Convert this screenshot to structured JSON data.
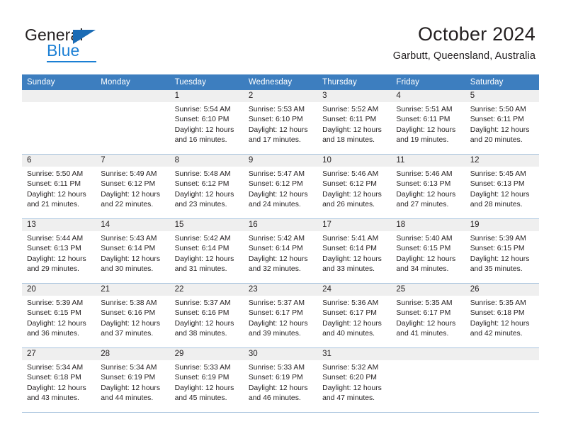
{
  "brand": {
    "name_part1": "General",
    "name_part2": "Blue",
    "accent_color": "#1b7fd4",
    "triangle_color": "#1b6cb5"
  },
  "header": {
    "title": "October 2024",
    "subtitle": "Garbutt, Queensland, Australia",
    "header_bg": "#3d7ebf",
    "daynum_bg": "#efefef"
  },
  "weekdays": [
    "Sunday",
    "Monday",
    "Tuesday",
    "Wednesday",
    "Thursday",
    "Friday",
    "Saturday"
  ],
  "labels": {
    "sunrise": "Sunrise:",
    "sunset": "Sunset:",
    "daylight": "Daylight:"
  },
  "weeks": [
    [
      {
        "day": "",
        "sunrise": "",
        "sunset": "",
        "daylight_line1": "",
        "daylight_line2": ""
      },
      {
        "day": "",
        "sunrise": "",
        "sunset": "",
        "daylight_line1": "",
        "daylight_line2": ""
      },
      {
        "day": "1",
        "sunrise": "Sunrise: 5:54 AM",
        "sunset": "Sunset: 6:10 PM",
        "daylight_line1": "Daylight: 12 hours",
        "daylight_line2": "and 16 minutes."
      },
      {
        "day": "2",
        "sunrise": "Sunrise: 5:53 AM",
        "sunset": "Sunset: 6:10 PM",
        "daylight_line1": "Daylight: 12 hours",
        "daylight_line2": "and 17 minutes."
      },
      {
        "day": "3",
        "sunrise": "Sunrise: 5:52 AM",
        "sunset": "Sunset: 6:11 PM",
        "daylight_line1": "Daylight: 12 hours",
        "daylight_line2": "and 18 minutes."
      },
      {
        "day": "4",
        "sunrise": "Sunrise: 5:51 AM",
        "sunset": "Sunset: 6:11 PM",
        "daylight_line1": "Daylight: 12 hours",
        "daylight_line2": "and 19 minutes."
      },
      {
        "day": "5",
        "sunrise": "Sunrise: 5:50 AM",
        "sunset": "Sunset: 6:11 PM",
        "daylight_line1": "Daylight: 12 hours",
        "daylight_line2": "and 20 minutes."
      }
    ],
    [
      {
        "day": "6",
        "sunrise": "Sunrise: 5:50 AM",
        "sunset": "Sunset: 6:11 PM",
        "daylight_line1": "Daylight: 12 hours",
        "daylight_line2": "and 21 minutes."
      },
      {
        "day": "7",
        "sunrise": "Sunrise: 5:49 AM",
        "sunset": "Sunset: 6:12 PM",
        "daylight_line1": "Daylight: 12 hours",
        "daylight_line2": "and 22 minutes."
      },
      {
        "day": "8",
        "sunrise": "Sunrise: 5:48 AM",
        "sunset": "Sunset: 6:12 PM",
        "daylight_line1": "Daylight: 12 hours",
        "daylight_line2": "and 23 minutes."
      },
      {
        "day": "9",
        "sunrise": "Sunrise: 5:47 AM",
        "sunset": "Sunset: 6:12 PM",
        "daylight_line1": "Daylight: 12 hours",
        "daylight_line2": "and 24 minutes."
      },
      {
        "day": "10",
        "sunrise": "Sunrise: 5:46 AM",
        "sunset": "Sunset: 6:12 PM",
        "daylight_line1": "Daylight: 12 hours",
        "daylight_line2": "and 26 minutes."
      },
      {
        "day": "11",
        "sunrise": "Sunrise: 5:46 AM",
        "sunset": "Sunset: 6:13 PM",
        "daylight_line1": "Daylight: 12 hours",
        "daylight_line2": "and 27 minutes."
      },
      {
        "day": "12",
        "sunrise": "Sunrise: 5:45 AM",
        "sunset": "Sunset: 6:13 PM",
        "daylight_line1": "Daylight: 12 hours",
        "daylight_line2": "and 28 minutes."
      }
    ],
    [
      {
        "day": "13",
        "sunrise": "Sunrise: 5:44 AM",
        "sunset": "Sunset: 6:13 PM",
        "daylight_line1": "Daylight: 12 hours",
        "daylight_line2": "and 29 minutes."
      },
      {
        "day": "14",
        "sunrise": "Sunrise: 5:43 AM",
        "sunset": "Sunset: 6:14 PM",
        "daylight_line1": "Daylight: 12 hours",
        "daylight_line2": "and 30 minutes."
      },
      {
        "day": "15",
        "sunrise": "Sunrise: 5:42 AM",
        "sunset": "Sunset: 6:14 PM",
        "daylight_line1": "Daylight: 12 hours",
        "daylight_line2": "and 31 minutes."
      },
      {
        "day": "16",
        "sunrise": "Sunrise: 5:42 AM",
        "sunset": "Sunset: 6:14 PM",
        "daylight_line1": "Daylight: 12 hours",
        "daylight_line2": "and 32 minutes."
      },
      {
        "day": "17",
        "sunrise": "Sunrise: 5:41 AM",
        "sunset": "Sunset: 6:14 PM",
        "daylight_line1": "Daylight: 12 hours",
        "daylight_line2": "and 33 minutes."
      },
      {
        "day": "18",
        "sunrise": "Sunrise: 5:40 AM",
        "sunset": "Sunset: 6:15 PM",
        "daylight_line1": "Daylight: 12 hours",
        "daylight_line2": "and 34 minutes."
      },
      {
        "day": "19",
        "sunrise": "Sunrise: 5:39 AM",
        "sunset": "Sunset: 6:15 PM",
        "daylight_line1": "Daylight: 12 hours",
        "daylight_line2": "and 35 minutes."
      }
    ],
    [
      {
        "day": "20",
        "sunrise": "Sunrise: 5:39 AM",
        "sunset": "Sunset: 6:15 PM",
        "daylight_line1": "Daylight: 12 hours",
        "daylight_line2": "and 36 minutes."
      },
      {
        "day": "21",
        "sunrise": "Sunrise: 5:38 AM",
        "sunset": "Sunset: 6:16 PM",
        "daylight_line1": "Daylight: 12 hours",
        "daylight_line2": "and 37 minutes."
      },
      {
        "day": "22",
        "sunrise": "Sunrise: 5:37 AM",
        "sunset": "Sunset: 6:16 PM",
        "daylight_line1": "Daylight: 12 hours",
        "daylight_line2": "and 38 minutes."
      },
      {
        "day": "23",
        "sunrise": "Sunrise: 5:37 AM",
        "sunset": "Sunset: 6:17 PM",
        "daylight_line1": "Daylight: 12 hours",
        "daylight_line2": "and 39 minutes."
      },
      {
        "day": "24",
        "sunrise": "Sunrise: 5:36 AM",
        "sunset": "Sunset: 6:17 PM",
        "daylight_line1": "Daylight: 12 hours",
        "daylight_line2": "and 40 minutes."
      },
      {
        "day": "25",
        "sunrise": "Sunrise: 5:35 AM",
        "sunset": "Sunset: 6:17 PM",
        "daylight_line1": "Daylight: 12 hours",
        "daylight_line2": "and 41 minutes."
      },
      {
        "day": "26",
        "sunrise": "Sunrise: 5:35 AM",
        "sunset": "Sunset: 6:18 PM",
        "daylight_line1": "Daylight: 12 hours",
        "daylight_line2": "and 42 minutes."
      }
    ],
    [
      {
        "day": "27",
        "sunrise": "Sunrise: 5:34 AM",
        "sunset": "Sunset: 6:18 PM",
        "daylight_line1": "Daylight: 12 hours",
        "daylight_line2": "and 43 minutes."
      },
      {
        "day": "28",
        "sunrise": "Sunrise: 5:34 AM",
        "sunset": "Sunset: 6:19 PM",
        "daylight_line1": "Daylight: 12 hours",
        "daylight_line2": "and 44 minutes."
      },
      {
        "day": "29",
        "sunrise": "Sunrise: 5:33 AM",
        "sunset": "Sunset: 6:19 PM",
        "daylight_line1": "Daylight: 12 hours",
        "daylight_line2": "and 45 minutes."
      },
      {
        "day": "30",
        "sunrise": "Sunrise: 5:33 AM",
        "sunset": "Sunset: 6:19 PM",
        "daylight_line1": "Daylight: 12 hours",
        "daylight_line2": "and 46 minutes."
      },
      {
        "day": "31",
        "sunrise": "Sunrise: 5:32 AM",
        "sunset": "Sunset: 6:20 PM",
        "daylight_line1": "Daylight: 12 hours",
        "daylight_line2": "and 47 minutes."
      },
      {
        "day": "",
        "sunrise": "",
        "sunset": "",
        "daylight_line1": "",
        "daylight_line2": ""
      },
      {
        "day": "",
        "sunrise": "",
        "sunset": "",
        "daylight_line1": "",
        "daylight_line2": ""
      }
    ]
  ]
}
